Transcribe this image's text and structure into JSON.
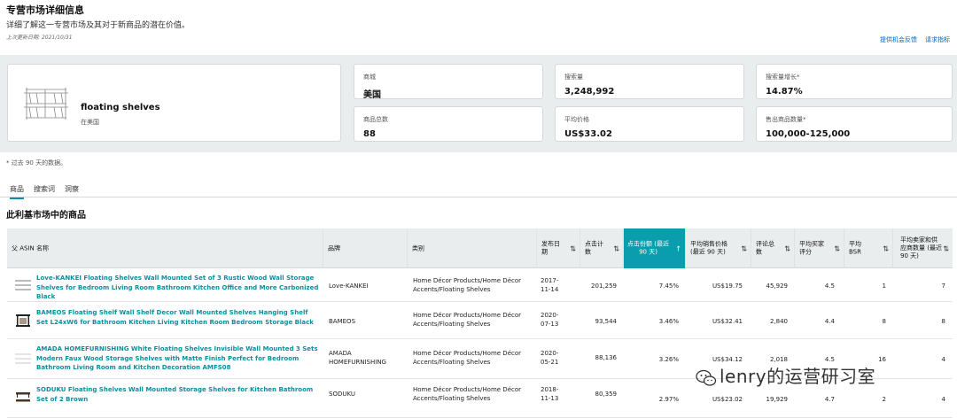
{
  "header": {
    "title": "专营市场详细信息",
    "subtitle": "详细了解这一专营市场及其对于新商品的潜在价值。",
    "updated": "上次更新日期: 2021/10/31",
    "links": [
      "提供机会反馈",
      "请求指标"
    ]
  },
  "product_card": {
    "name": "floating shelves",
    "market": "在美国"
  },
  "stats": [
    {
      "label": "商城",
      "value": "美国"
    },
    {
      "label": "搜索量",
      "value": "3,248,992"
    },
    {
      "label": "搜索量增长*",
      "value": "14.87%"
    },
    {
      "label": "商品总数",
      "value": "88"
    },
    {
      "label": "平均价格",
      "value": "US$33.02"
    },
    {
      "label": "售出商品数量*",
      "value": "100,000-125,000"
    }
  ],
  "footnote": "* 过去 90 天的数据。",
  "tabs": [
    "商品",
    "搜索词",
    "洞察"
  ],
  "section_title": "此利基市场中的商品",
  "table": {
    "headers": {
      "asin": "父 ASIN 名称",
      "brand": "品牌",
      "category": "类别",
      "date": "发布日期",
      "clicks": "点击计数",
      "share": "点击份额 (最近 90 天)",
      "price": "平均销售价格 (最近 90 天)",
      "reviews": "评论总数",
      "rating": "平均买家评分",
      "bsr": "平均 BSR",
      "sellers": "平均卖家和供应商数量 (最近 90 天)"
    },
    "rows": [
      {
        "name": "Love-KANKEI Floating Shelves Wall Mounted Set of 3 Rustic Wood Wall Storage Shelves for Bedroom Living Room Bathroom Kitchen Office and More Carbonized Black",
        "brand": "Love-KANKEI",
        "category": "Home Décor Products/Home Décor Accents/Floating Shelves",
        "date": "2017-11-14",
        "clicks": "201,259",
        "share": "7.45%",
        "price": "US$19.75",
        "reviews": "45,929",
        "rating": "4.5",
        "bsr": "1",
        "sellers": "7"
      },
      {
        "name": "BAMEOS Floating Shelf Wall Shelf Decor Wall Mounted Shelves Hanging Shelf Set L24xW6 for Bathroom Kitchen Living Kitchen Room Bedroom Storage Black",
        "brand": "BAMEOS",
        "category": "Home Décor Products/Home Décor Accents/Floating Shelves",
        "date": "2020-07-13",
        "clicks": "93,544",
        "share": "3.46%",
        "price": "US$32.41",
        "reviews": "2,840",
        "rating": "4.4",
        "bsr": "8",
        "sellers": "8"
      },
      {
        "name": "AMADA HOMEFURNISHING White Floating Shelves Invisible Wall Mounted 3 Sets Modern Faux Wood Storage Shelves with Matte Finish Perfect for Bedroom Bathroom Living Room and Kitchen Decoration AMFS08",
        "brand": "AMADA HOMEFURNISHING",
        "category": "Home Décor Products/Home Décor Accents/Floating Shelves",
        "date": "2020-05-21",
        "clicks": "88,136",
        "share": "3.26%",
        "price": "US$34.12",
        "reviews": "2,018",
        "rating": "4.5",
        "bsr": "16",
        "sellers": "4"
      },
      {
        "name": "SODUKU Floating Shelves Wall Mounted Storage Shelves for Kitchen Bathroom Set of 2 Brown",
        "brand": "SODUKU",
        "category": "Home Décor Products/Home Décor Accents/Floating Shelves",
        "date": "2018-11-13",
        "clicks": "80,359",
        "share": "2.97%",
        "price": "US$23.02",
        "reviews": "19,929",
        "rating": "4.7",
        "bsr": "2",
        "sellers": "4"
      }
    ]
  },
  "watermark": "lenry的运营研习室",
  "colors": {
    "accent": "#0a9dad",
    "link": "#0a8f9e",
    "panel": "#eaedee"
  }
}
